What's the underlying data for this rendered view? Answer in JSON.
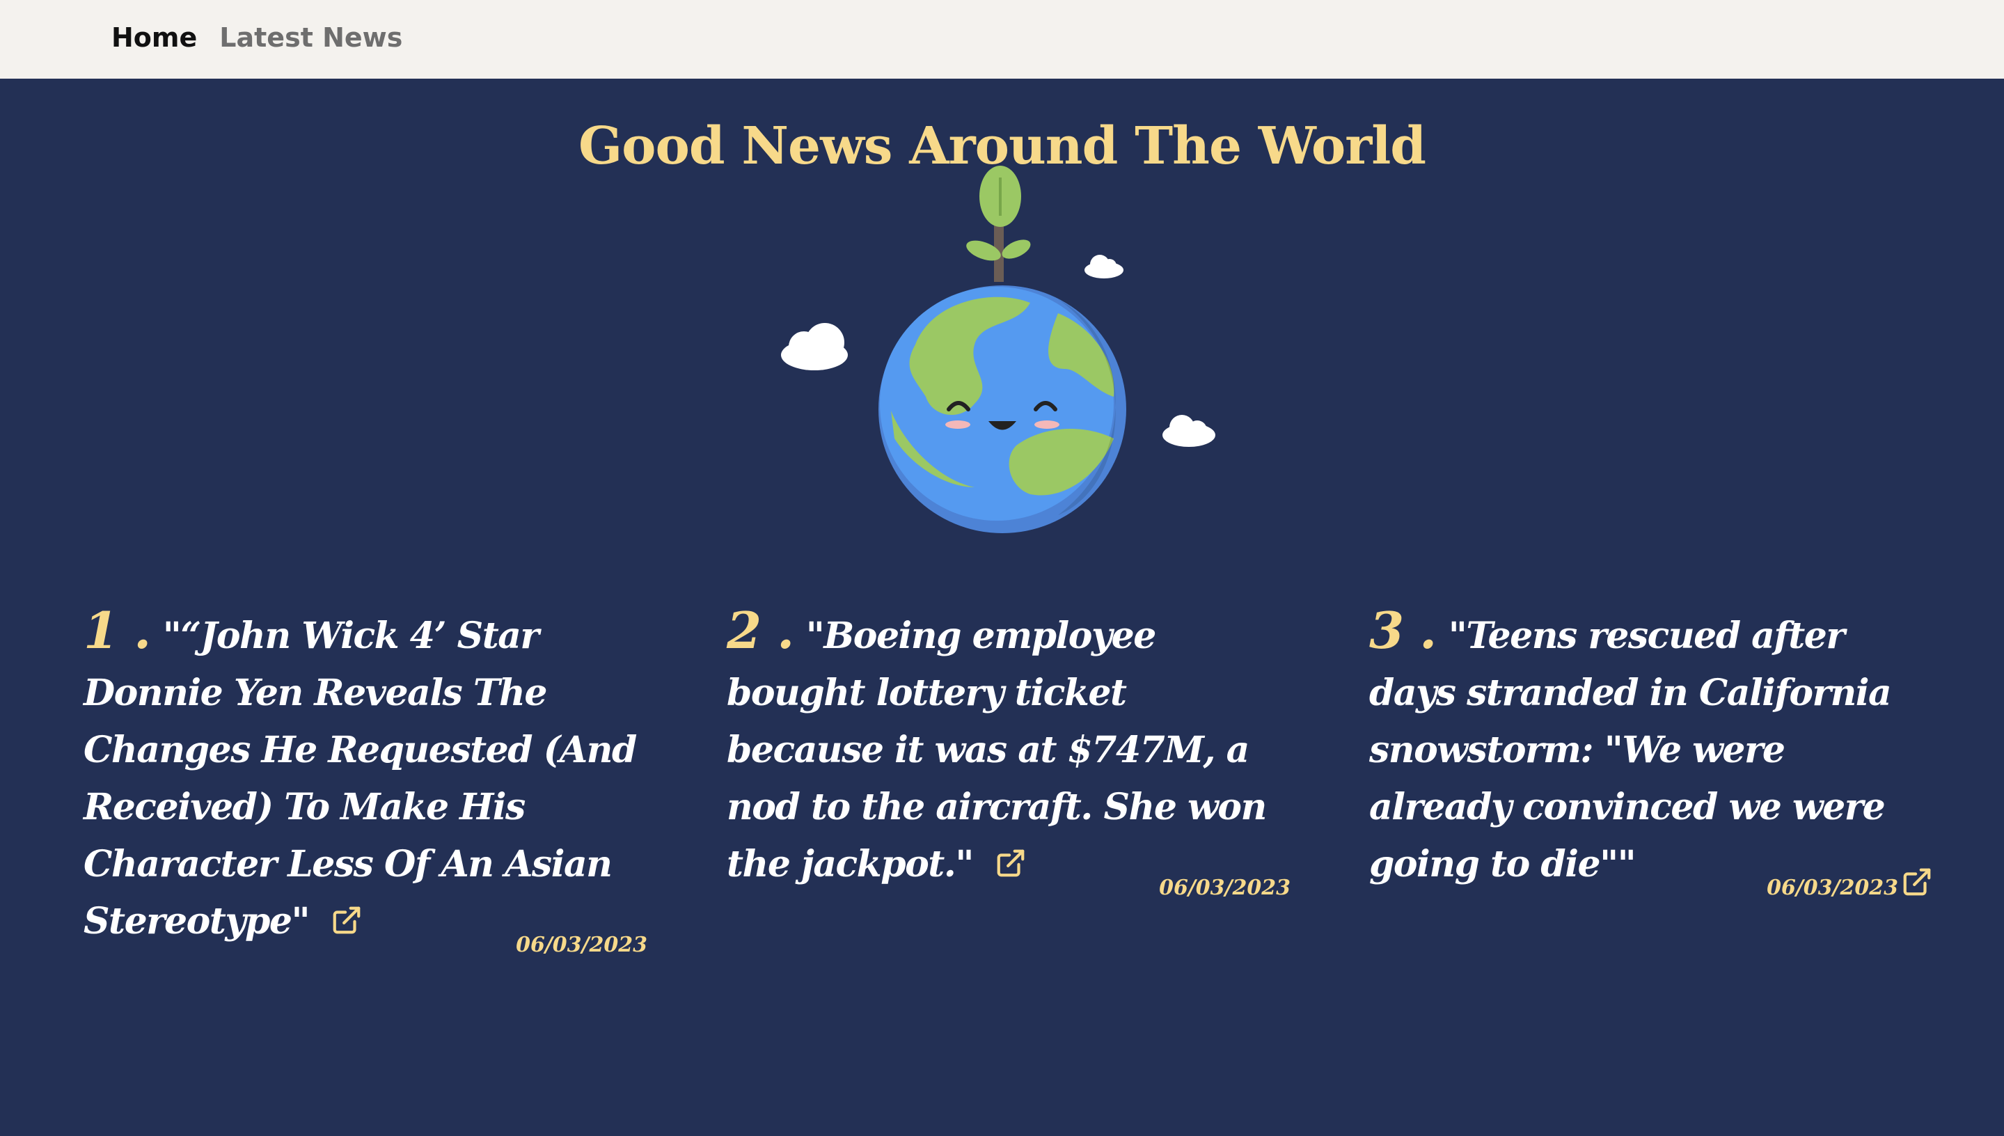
{
  "nav": {
    "home": "Home",
    "latest": "Latest News"
  },
  "hero": {
    "title": "Good News Around The World",
    "illustration": "smiling-earth-with-sprout-and-clouds"
  },
  "articles": [
    {
      "number": "1 .",
      "title": "\"“John Wick 4’ Star Donnie Yen Reveals The Changes He Requested (And Received) To Make His Character Less Of An Asian Stereotype\"",
      "date": "06/03/2023",
      "link_icon": "external-link-icon"
    },
    {
      "number": "2 .",
      "title": "\"Boeing employee bought lottery ticket because it was at $747M, a nod to the aircraft. She won the jackpot.\"",
      "date": "06/03/2023",
      "link_icon": "external-link-icon"
    },
    {
      "number": "3 .",
      "title": "\"Teens rescued after days stranded in California snowstorm: \"We were already convinced we were going to die\"\"",
      "date": "06/03/2023",
      "link_icon": "external-link-icon"
    }
  ],
  "colors": {
    "background": "#233055",
    "navbar": "#f4f2ee",
    "accent": "#f7d98a",
    "text": "#ffffff"
  }
}
